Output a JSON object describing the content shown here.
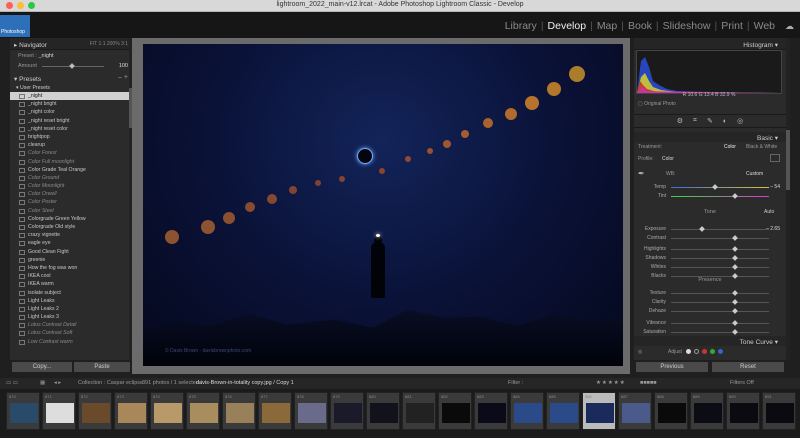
{
  "window": {
    "title": "lightroom_2022_main-v12.lrcat - Adobe Photoshop Lightroom Classic - Develop"
  },
  "brand": {
    "logo_text": "Photoshop"
  },
  "modules": [
    {
      "label": "Library",
      "active": false
    },
    {
      "label": "Develop",
      "active": true
    },
    {
      "label": "Map",
      "active": false
    },
    {
      "label": "Book",
      "active": false
    },
    {
      "label": "Slideshow",
      "active": false
    },
    {
      "label": "Print",
      "active": false
    },
    {
      "label": "Web",
      "active": false
    }
  ],
  "left_panel": {
    "navigator": {
      "title": "Navigator",
      "zoom_options": "FIT  1:1  200%  3:1",
      "preset_label": "Preset",
      "preset_value": "_night",
      "amount_label": "Amount",
      "amount_value": "100"
    },
    "presets": {
      "title": "Presets",
      "folder": "User Presets",
      "items": [
        {
          "label": "_night",
          "selected": true,
          "dim": false
        },
        {
          "label": "_night bright",
          "selected": false,
          "dim": false
        },
        {
          "label": "_night color",
          "selected": false,
          "dim": false
        },
        {
          "label": "_night reset bright",
          "selected": false,
          "dim": false
        },
        {
          "label": "_night reset color",
          "selected": false,
          "dim": false
        },
        {
          "label": "brightpop",
          "selected": false,
          "dim": false
        },
        {
          "label": "clearup",
          "selected": false,
          "dim": false
        },
        {
          "label": "Color Forest",
          "selected": false,
          "dim": true
        },
        {
          "label": "Color Full moonlight",
          "selected": false,
          "dim": true
        },
        {
          "label": "Color Grade Teal Orange",
          "selected": false,
          "dim": false
        },
        {
          "label": "Color Ground",
          "selected": false,
          "dim": true
        },
        {
          "label": "Color Moonlight",
          "selected": false,
          "dim": true
        },
        {
          "label": "Color Orwell",
          "selected": false,
          "dim": true
        },
        {
          "label": "Color Poster",
          "selected": false,
          "dim": true
        },
        {
          "label": "Color Steel",
          "selected": false,
          "dim": true
        },
        {
          "label": "Colorgrade Green Yellow",
          "selected": false,
          "dim": false
        },
        {
          "label": "Colorgrade Old style",
          "selected": false,
          "dim": false
        },
        {
          "label": "crazy vignette",
          "selected": false,
          "dim": false
        },
        {
          "label": "eagle eye",
          "selected": false,
          "dim": false
        },
        {
          "label": "Good Clean Fight",
          "selected": false,
          "dim": false
        },
        {
          "label": "greenie",
          "selected": false,
          "dim": false
        },
        {
          "label": "How the fog was won",
          "selected": false,
          "dim": false
        },
        {
          "label": "IKEA cool",
          "selected": false,
          "dim": false
        },
        {
          "label": "IKEA warm",
          "selected": false,
          "dim": false
        },
        {
          "label": "isolate subject",
          "selected": false,
          "dim": false
        },
        {
          "label": "Light Leaks",
          "selected": false,
          "dim": false
        },
        {
          "label": "Light Leaks 2",
          "selected": false,
          "dim": false
        },
        {
          "label": "Light Leaks 3",
          "selected": false,
          "dim": false
        },
        {
          "label": "Lotus Contrast Detail",
          "selected": false,
          "dim": true
        },
        {
          "label": "Lotus Contrast Soft",
          "selected": false,
          "dim": true
        },
        {
          "label": "Low Contrast warm",
          "selected": false,
          "dim": true
        }
      ]
    },
    "copy_label": "Copy...",
    "paste_label": "Paste"
  },
  "photo": {
    "watermark": "© Davis Brown · davisbrownphoto.com"
  },
  "right_panel": {
    "histogram": {
      "title": "Histogram",
      "readout": "R 10.6   G 13.4   B 32.9 %",
      "original_photo": "Original Photo"
    },
    "basic": {
      "title": "Basic",
      "treatment_label": "Treatment:",
      "treatment_color": "Color",
      "treatment_bw": "Black & White",
      "profile_label": "Profile:",
      "profile_value": "Color",
      "wb_label": "WB:",
      "wb_value": "Custom",
      "tone_label": "Tone",
      "tone_auto": "Auto",
      "presence_label": "Presence",
      "sliders": [
        {
          "label": "Temp",
          "value": "– 54",
          "pos": 0.45
        },
        {
          "label": "Tint",
          "value": "",
          "pos": 0.65
        },
        {
          "label": "Exposure",
          "value": "– 2.65",
          "pos": 0.32
        },
        {
          "label": "Contrast",
          "value": "",
          "pos": 0.65
        },
        {
          "label": "Highlights",
          "value": "",
          "pos": 0.65
        },
        {
          "label": "Shadows",
          "value": "",
          "pos": 0.65
        },
        {
          "label": "Whites",
          "value": "",
          "pos": 0.65
        },
        {
          "label": "Blacks",
          "value": "",
          "pos": 0.65
        },
        {
          "label": "Texture",
          "value": "",
          "pos": 0.65
        },
        {
          "label": "Clarity",
          "value": "",
          "pos": 0.65
        },
        {
          "label": "Dehaze",
          "value": "",
          "pos": 0.65
        },
        {
          "label": "Vibrance",
          "value": "",
          "pos": 0.65
        },
        {
          "label": "Saturation",
          "value": "",
          "pos": 0.65
        }
      ]
    },
    "tone_curve": {
      "title": "Tone Curve",
      "adjust_label": "Adjust"
    },
    "previous_label": "Previous",
    "reset_label": "Reset"
  },
  "filmstrip_bar": {
    "collection": "Collection : Caspar eclipse",
    "count": "391 photos / 1 selected /",
    "filename": "davis-Brown-in-totality copy.jpg / Copy 1",
    "filter_label": "Filter :",
    "filters_off": "Filters Off"
  },
  "filmstrip": {
    "numbers": [
      "870",
      "871",
      "872",
      "873",
      "874",
      "875",
      "876",
      "877",
      "878",
      "879",
      "880",
      "881",
      "882",
      "883",
      "884",
      "885",
      "886",
      "887",
      "888",
      "889",
      "890",
      "891"
    ]
  },
  "colors": {
    "accent": "#2d6fb8",
    "panel": "#2b2b2b",
    "ring": "#6fa8ff"
  }
}
